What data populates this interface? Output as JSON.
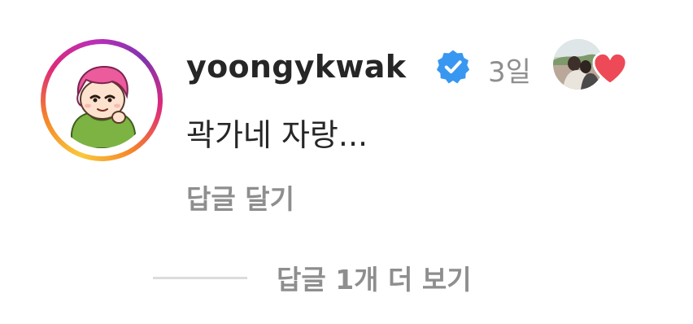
{
  "comment": {
    "username": "yoongykwak",
    "verified": true,
    "time": "3일",
    "text": "곽가네 자랑...",
    "reply_label": "답글 달기",
    "liked_by_author": true
  },
  "replies": {
    "view_label": "답글 1개 더 보기"
  },
  "icons": {
    "verified": "verified-badge-icon",
    "heart": "heart-icon"
  },
  "colors": {
    "text_primary": "#262626",
    "text_secondary": "#8e8e8e",
    "verified_blue": "#3897f0",
    "heart_red": "#ed4956",
    "divider": "#dbdbdb"
  }
}
